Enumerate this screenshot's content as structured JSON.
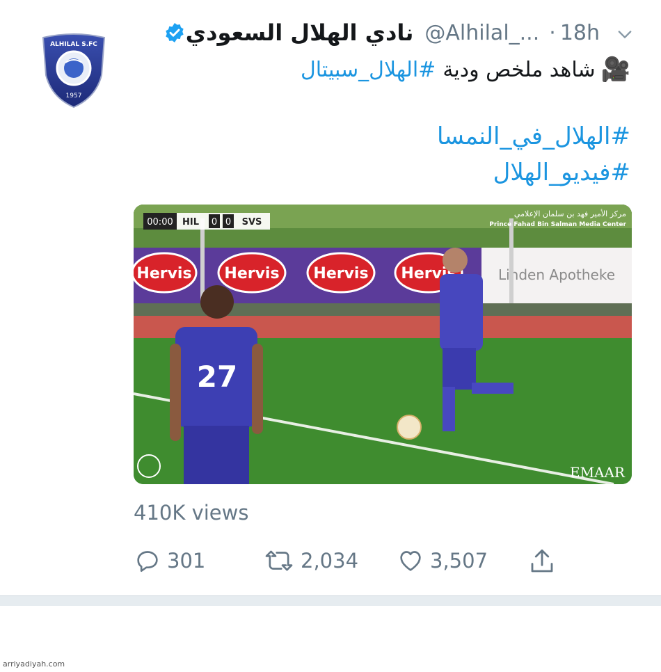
{
  "tweet": {
    "author_name": "نادي الهلال السعودي",
    "handle": "@Alhilal_...",
    "separator": "·",
    "time": "18h",
    "text_hashtag": "#الهلال_سبيتال",
    "text_body": "شاهد ملخص ودية",
    "text_emoji": "🎥",
    "hashtag_2": "#الهلال_في_النمسا",
    "hashtag_3": "#فيديو_الهلال",
    "views": "410K views",
    "replies": "301",
    "retweets": "2,034",
    "likes": "3,507"
  },
  "avatar": {
    "logo_text": "ALHILAL S.FC",
    "year": "1957"
  },
  "video": {
    "score_time": "00:00",
    "team_home": "HIL",
    "score_home": "0",
    "score_away": "0",
    "team_away": "SVS",
    "media_center_ar": "مركز الأمير فهد بن سلمان الإعلامي",
    "media_center_en": "Prince Fahad Bin Salman Media Center",
    "board_ads": [
      "Hervis",
      "Hervis",
      "Hervis",
      "Hervis"
    ],
    "board_right": "Linden Apotheke",
    "player_number": "27",
    "watermark": "EMAAR"
  },
  "footer": {
    "source": "arriyadiyah.com"
  },
  "colors": {
    "link": "#1b95e0",
    "muted": "#657786",
    "verified": "#1da1f2",
    "text": "#14171a"
  },
  "icons": [
    "verified-icon",
    "chevron-down-icon",
    "video-camera-icon",
    "reply-icon",
    "retweet-icon",
    "like-icon",
    "share-icon"
  ]
}
